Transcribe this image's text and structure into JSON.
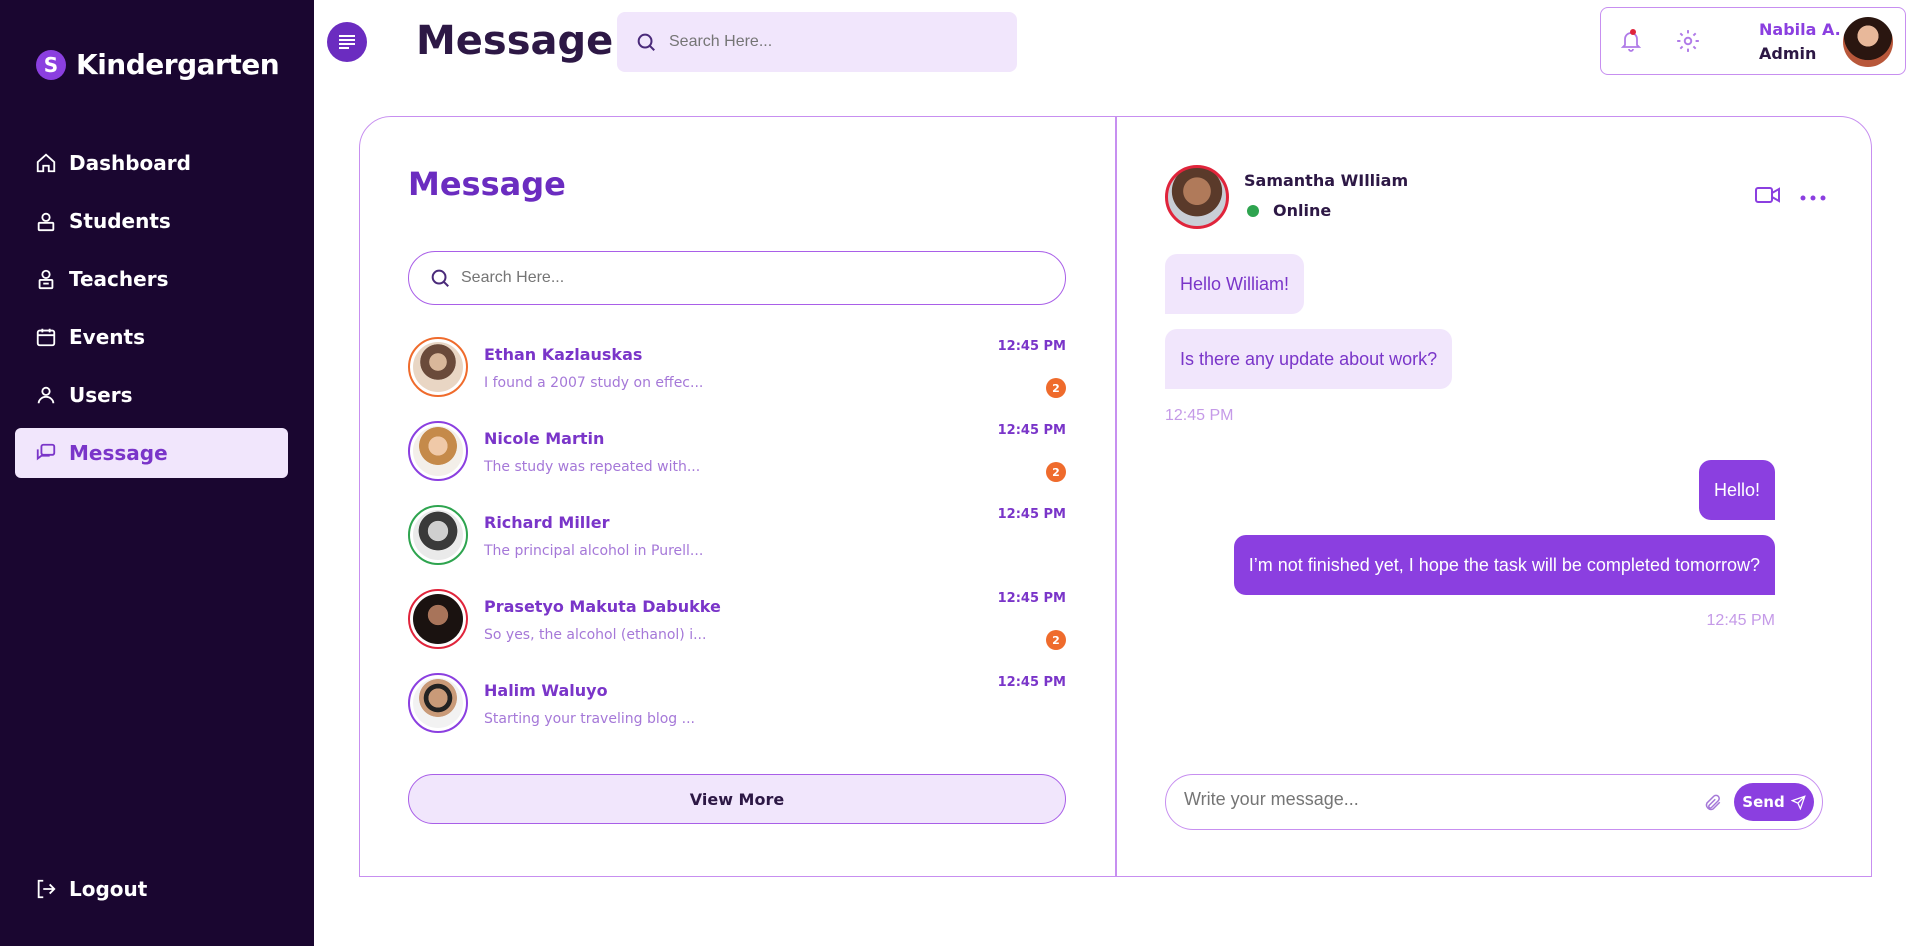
{
  "brand": {
    "logo_letter": "S",
    "name": "Kindergarten"
  },
  "sidebar": {
    "items": [
      {
        "label": "Dashboard",
        "icon": "home-icon"
      },
      {
        "label": "Students",
        "icon": "student-icon"
      },
      {
        "label": "Teachers",
        "icon": "teacher-icon"
      },
      {
        "label": "Events",
        "icon": "calendar-icon"
      },
      {
        "label": "Users",
        "icon": "user-icon"
      },
      {
        "label": "Message",
        "icon": "chat-icon",
        "active": true
      }
    ],
    "logout_label": "Logout"
  },
  "header": {
    "title": "Message",
    "search_placeholder": "Search Here...",
    "user_name": "Nabila A.",
    "user_role": "Admin"
  },
  "messages_panel": {
    "title": "Message",
    "search_placeholder": "Search Here...",
    "contacts": [
      {
        "name": "Ethan Kazlauskas",
        "preview": "I found a 2007 study on effec...",
        "time": "12:45 PM",
        "unread": "2"
      },
      {
        "name": "Nicole Martin",
        "preview": "The study was repeated with...",
        "time": "12:45 PM",
        "unread": "2"
      },
      {
        "name": "Richard Miller",
        "preview": "The principal alcohol in Purell...",
        "time": "12:45 PM",
        "unread": ""
      },
      {
        "name": "Prasetyo Makuta Dabukke",
        "preview": "So yes, the alcohol (ethanol) i...",
        "time": "12:45 PM",
        "unread": "2"
      },
      {
        "name": "Halim Waluyo",
        "preview": "Starting your traveling blog ...",
        "time": "12:45 PM",
        "unread": ""
      }
    ],
    "view_more_label": "View More"
  },
  "chat": {
    "contact_name": "Samantha WIlliam",
    "status": "Online",
    "incoming": [
      "Hello William!",
      "Is there any update about work?"
    ],
    "incoming_time": "12:45 PM",
    "outgoing": [
      "Hello!",
      "I’m not finished yet, I hope the task will be completed tomorrow?"
    ],
    "outgoing_time": "12:45 PM",
    "composer_placeholder": "Write your message...",
    "send_label": "Send"
  },
  "colors": {
    "sidebar_bg": "#1a0630",
    "accent": "#8b3fe0",
    "accent_light": "#f1e6fc",
    "badge": "#ef6b2c",
    "online": "#2ea44f"
  }
}
